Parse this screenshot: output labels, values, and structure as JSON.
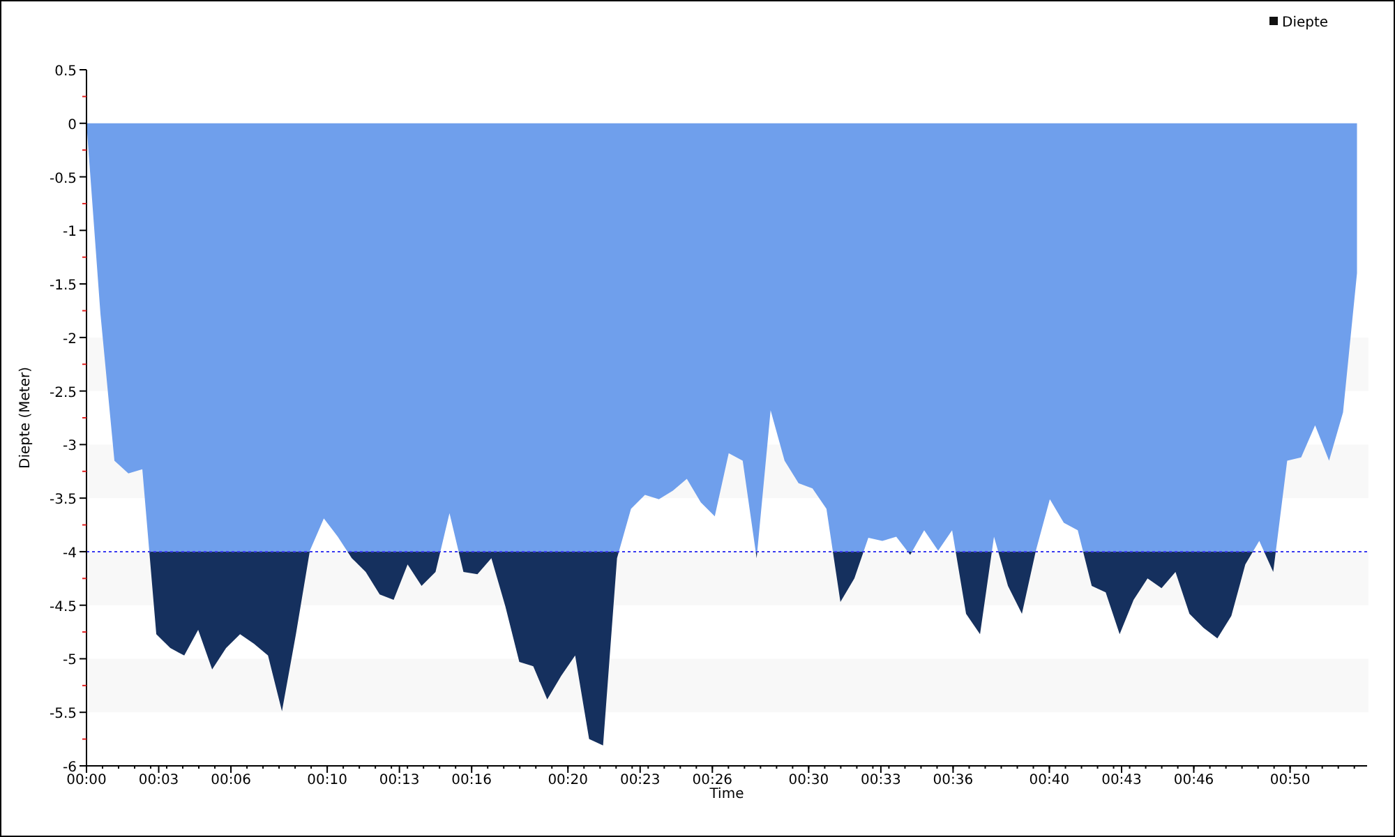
{
  "chart_data": {
    "type": "area",
    "xlabel": "Time",
    "ylabel": "Diepte (Meter)",
    "xlim": [
      0,
      53.2
    ],
    "ylim": [
      -6,
      0.5
    ],
    "xticks": [
      {
        "value": 0,
        "label": "00:00"
      },
      {
        "value": 3,
        "label": "00:03"
      },
      {
        "value": 6,
        "label": "00:06"
      },
      {
        "value": 10,
        "label": "00:10"
      },
      {
        "value": 13,
        "label": "00:13"
      },
      {
        "value": 16,
        "label": "00:16"
      },
      {
        "value": 20,
        "label": "00:20"
      },
      {
        "value": 23,
        "label": "00:23"
      },
      {
        "value": 26,
        "label": "00:26"
      },
      {
        "value": 30,
        "label": "00:30"
      },
      {
        "value": 33,
        "label": "00:33"
      },
      {
        "value": 36,
        "label": "00:36"
      },
      {
        "value": 40,
        "label": "00:40"
      },
      {
        "value": 43,
        "label": "00:43"
      },
      {
        "value": 46,
        "label": "00:46"
      },
      {
        "value": 50,
        "label": "00:50"
      }
    ],
    "yticks": [
      0.5,
      0,
      -0.5,
      -1,
      -1.5,
      -2,
      -2.5,
      -3,
      -3.5,
      -4,
      -4.5,
      -5,
      -5.5,
      -6
    ],
    "x": [
      0,
      0.58,
      1.16,
      1.74,
      2.32,
      2.9,
      3.48,
      4.06,
      4.64,
      5.22,
      5.8,
      6.38,
      6.96,
      7.54,
      8.12,
      8.7,
      9.28,
      9.86,
      10.44,
      11.02,
      11.6,
      12.18,
      12.76,
      13.34,
      13.92,
      14.5,
      15.08,
      15.66,
      16.24,
      16.82,
      17.4,
      17.98,
      18.56,
      19.14,
      19.72,
      20.3,
      20.88,
      21.46,
      22.04,
      22.62,
      23.2,
      23.78,
      24.36,
      24.94,
      25.52,
      26.1,
      26.68,
      27.26,
      27.84,
      28.42,
      29,
      29.58,
      30.16,
      30.74,
      31.32,
      31.9,
      32.48,
      33.06,
      33.64,
      34.22,
      34.8,
      35.38,
      35.96,
      36.54,
      37.12,
      37.7,
      38.28,
      38.86,
      39.44,
      40.02,
      40.6,
      41.18,
      41.76,
      42.34,
      42.92,
      43.5,
      44.08,
      44.66,
      45.24,
      45.82,
      46.4,
      46.98,
      47.56,
      48.14,
      48.72,
      49.3,
      49.88,
      50.46,
      51.04,
      51.62,
      52.2,
      52.78
    ],
    "series": [
      {
        "name": "Diepte",
        "color": "#6f9fec",
        "values": [
          0,
          -1.78,
          -3.15,
          -3.27,
          -3.23,
          -4.77,
          -4.9,
          -4.97,
          -4.73,
          -5.1,
          -4.9,
          -4.77,
          -4.86,
          -4.97,
          -5.49,
          -4.77,
          -3.99,
          -3.69,
          -3.86,
          -4.06,
          -4.19,
          -4.4,
          -4.45,
          -4.12,
          -4.32,
          -4.19,
          -3.64,
          -4.19,
          -4.21,
          -4.06,
          -4.51,
          -5.03,
          -5.07,
          -5.38,
          -5.16,
          -4.97,
          -5.75,
          -5.81,
          -4.06,
          -3.6,
          -3.47,
          -3.51,
          -3.43,
          -3.32,
          -3.54,
          -3.67,
          -3.08,
          -3.15,
          -4.06,
          -2.68,
          -3.15,
          -3.36,
          -3.41,
          -3.6,
          -4.47,
          -4.25,
          -3.87,
          -3.9,
          -3.86,
          -4.03,
          -3.8,
          -3.99,
          -3.8,
          -4.58,
          -4.77,
          -3.86,
          -4.32,
          -4.58,
          -3.99,
          -3.51,
          -3.73,
          -3.8,
          -4.32,
          -4.38,
          -4.77,
          -4.45,
          -4.25,
          -4.34,
          -4.19,
          -4.58,
          -4.71,
          -4.81,
          -4.6,
          -4.12,
          -3.9,
          -4.19,
          -3.15,
          -3.12,
          -2.82,
          -3.15,
          -2.7,
          -1.4
        ]
      }
    ],
    "ref_lines": [
      {
        "axis": "y",
        "value": -4
      }
    ]
  }
}
